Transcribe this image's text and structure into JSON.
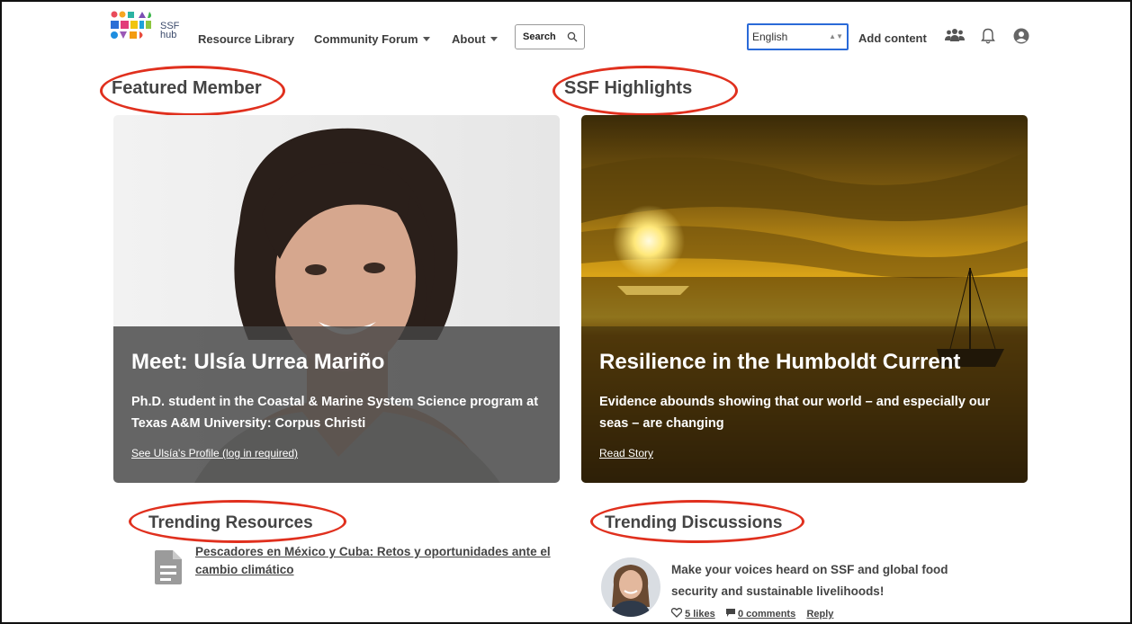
{
  "brand": {
    "logo_text_1": "SSF",
    "logo_text_2": "hub"
  },
  "nav": {
    "resource_library": "Resource Library",
    "community_forum": "Community Forum",
    "about": "About",
    "search_label": "Search",
    "language_selected": "English",
    "add_content": "Add content"
  },
  "icons": {
    "search": "search-icon",
    "members": "group-icon",
    "notifications": "bell-icon",
    "account": "user-circle-icon"
  },
  "colors": {
    "annotation_red": "#e0301e",
    "language_focus": "#2a6ad8"
  },
  "featured": {
    "heading": "Featured Member",
    "title": "Meet: Ulsía Urrea Mariño",
    "description": "Ph.D. student in the Coastal & Marine System Science program at Texas A&M University: Corpus Christi",
    "link": "See Ulsía's Profile (log in required)"
  },
  "highlights": {
    "heading": "SSF Highlights",
    "title": "Resilience in the Humboldt Current",
    "description": "Evidence abounds showing that our world – and especially our seas – are changing",
    "link": "Read Story"
  },
  "trending_resources": {
    "heading": "Trending Resources",
    "item_title": "Pescadores en México y Cuba: Retos y oportunidades ante el cambio climático"
  },
  "trending_discussions": {
    "heading": "Trending Discussions",
    "item_title": "Make your voices heard on SSF and global food security and sustainable livelihoods!",
    "likes": "5 likes",
    "comments": "0 comments",
    "reply": "Reply"
  }
}
